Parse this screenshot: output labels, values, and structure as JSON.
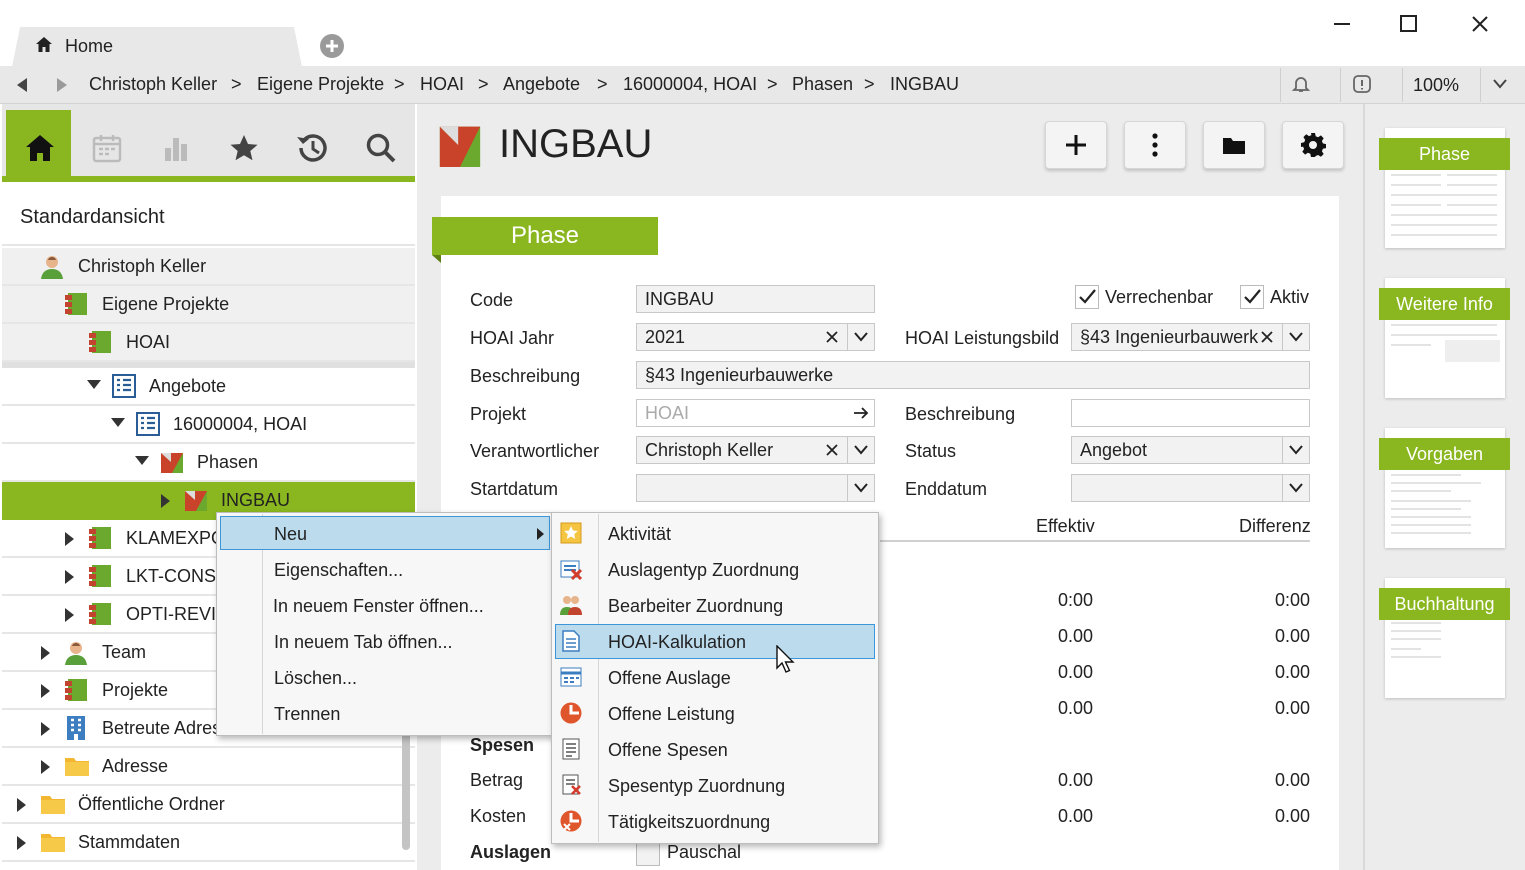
{
  "window": {
    "tab_label": "Home"
  },
  "breadcrumb": [
    "Christoph Keller",
    "Eigene Projekte",
    "HOAI",
    "Angebote",
    "16000004, HOAI",
    "Phasen",
    "INGBAU"
  ],
  "breadcrumb_separator": ">",
  "zoom": "100%",
  "sidebar": {
    "view_title": "Standardansicht",
    "tree": [
      {
        "label": "Christoph Keller"
      },
      {
        "label": "Eigene Projekte"
      },
      {
        "label": "HOAI"
      },
      {
        "label": "Angebote"
      },
      {
        "label": "16000004, HOAI"
      },
      {
        "label": "Phasen"
      },
      {
        "label": "INGBAU"
      },
      {
        "label": "KLAMEXPO"
      },
      {
        "label": "LKT-CONSU"
      },
      {
        "label": "OPTI-REVIS"
      },
      {
        "label": "Team"
      },
      {
        "label": "Projekte"
      },
      {
        "label": "Betreute Adress"
      },
      {
        "label": "Adresse"
      },
      {
        "label": "Öffentliche Ordner"
      },
      {
        "label": "Stammdaten"
      }
    ]
  },
  "record": {
    "title": "INGBAU",
    "section_title": "Phase"
  },
  "form": {
    "code_label": "Code",
    "code_value": "INGBAU",
    "verrechenbar_label": "Verrechenbar",
    "aktiv_label": "Aktiv",
    "jahr_label": "HOAI Jahr",
    "jahr_value": "2021",
    "leistungsbild_label": "HOAI Leistungsbild",
    "leistungsbild_value": "§43 Ingenieurbauwerk",
    "beschreibung_label": "Beschreibung",
    "beschreibung_value": "§43 Ingenieurbauwerke",
    "projekt_label": "Projekt",
    "projekt_placeholder": "HOAI",
    "beschreibung2_label": "Beschreibung",
    "beschreibung2_value": "",
    "verantwortlicher_label": "Verantwortlicher",
    "verantwortlicher_value": "Christoph Keller",
    "status_label": "Status",
    "status_value": "Angebot",
    "startdatum_label": "Startdatum",
    "enddatum_label": "Enddatum",
    "col_effektiv": "Effektiv",
    "col_differenz": "Differenz",
    "rows": [
      {
        "effektiv": "0:00",
        "differenz": "0:00"
      },
      {
        "effektiv": "0.00",
        "differenz": "0.00"
      },
      {
        "effektiv": "0.00",
        "differenz": "0.00"
      },
      {
        "effektiv": "0.00",
        "differenz": "0.00"
      }
    ],
    "spesen_heading": "Spesen",
    "betrag_label": "Betrag",
    "betrag_effektiv": "0.00",
    "betrag_differenz": "0.00",
    "kosten_label": "Kosten",
    "kosten_effektiv": "0.00",
    "kosten_differenz": "0.00",
    "auslagen_heading": "Auslagen",
    "pauschal_label": "Pauschal"
  },
  "thumbnails": [
    "Phase",
    "Weitere Info",
    "Vorgaben",
    "Buchhaltung"
  ],
  "context_menu": [
    "Neu",
    "Eigenschaften...",
    "In neuem Fenster öffnen...",
    "In neuem Tab öffnen...",
    "Löschen...",
    "Trennen"
  ],
  "submenu": [
    "Aktivität",
    "Auslagentyp Zuordnung",
    "Bearbeiter Zuordnung",
    "HOAI-Kalkulation",
    "Offene Auslage",
    "Offene Leistung",
    "Offene Spesen",
    "Spesentyp Zuordnung",
    "Tätigkeitszuordnung"
  ],
  "colors": {
    "accent": "#8ab71f",
    "highlight": "#bcdcee",
    "highlight_border": "#3d96d8"
  }
}
